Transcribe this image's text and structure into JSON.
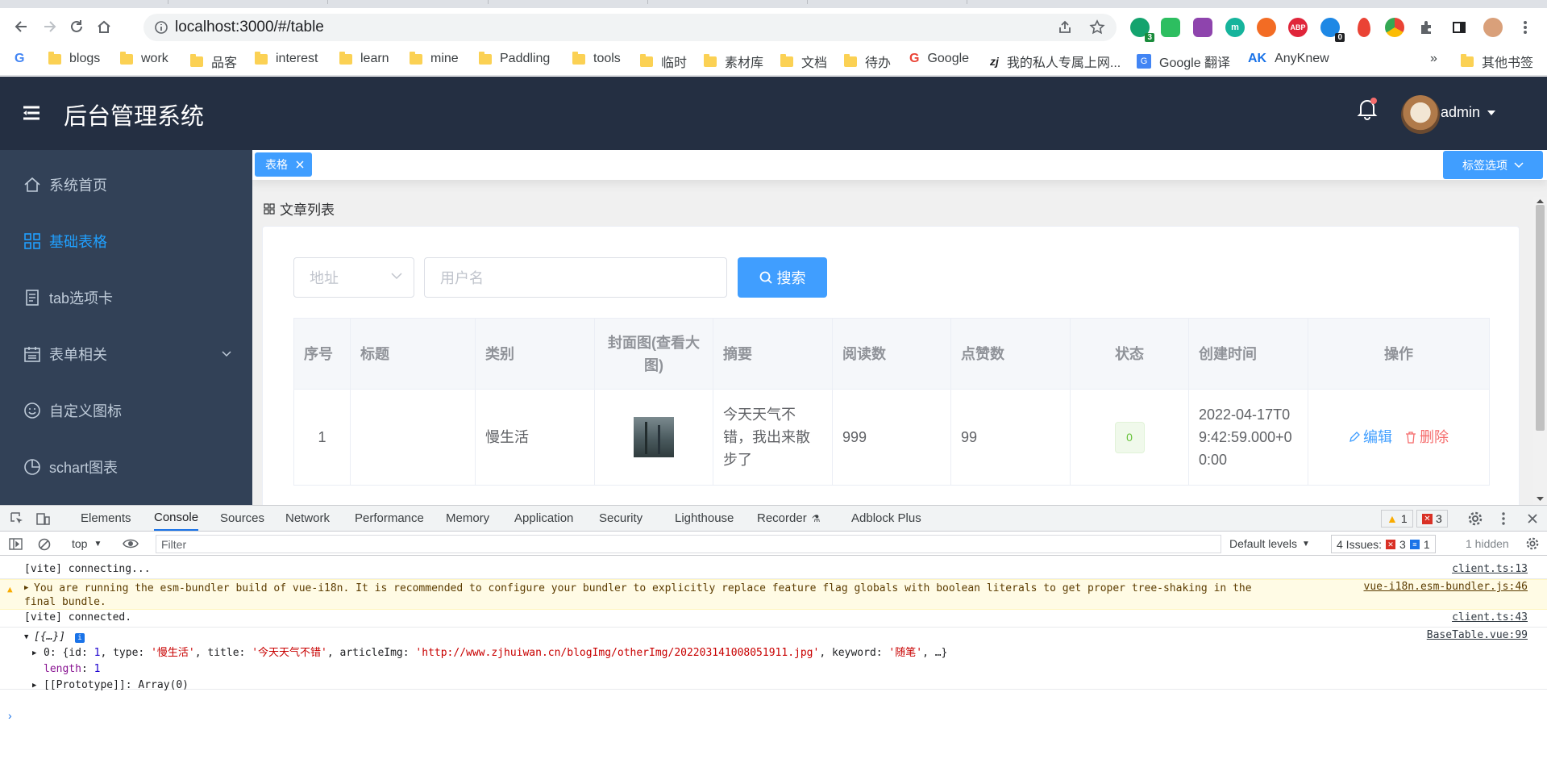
{
  "browser": {
    "url": "localhost:3000/#/table",
    "bookmarks": [
      "blogs",
      "work",
      "品客",
      "interest",
      "learn",
      "mine",
      "Paddling",
      "tools",
      "临时",
      "素材库",
      "文档",
      "待办"
    ],
    "bookmark_google": "Google",
    "bookmark_zj": "我的私人专属上网...",
    "bookmark_translate": "Google 翻译",
    "bookmark_anyknew": "AnyKnew",
    "bookmark_other": "其他书签",
    "ext_badges": {
      "first": "3",
      "second": "0"
    },
    "abp": "ABP"
  },
  "app": {
    "title": "后台管理系统",
    "user": "admin"
  },
  "sidebar": {
    "items": [
      {
        "label": "系统首页"
      },
      {
        "label": "基础表格"
      },
      {
        "label": "tab选项卡"
      },
      {
        "label": "表单相关"
      },
      {
        "label": "自定义图标"
      },
      {
        "label": "schart图表"
      }
    ]
  },
  "tags": {
    "active": "表格",
    "options": "标签选项"
  },
  "page": {
    "breadcrumb": "文章列表",
    "filter_address_placeholder": "地址",
    "filter_username_placeholder": "用户名",
    "search_label": "搜索"
  },
  "table": {
    "headers": [
      "序号",
      "标题",
      "类别",
      "封面图(查看大图)",
      "摘要",
      "阅读数",
      "点赞数",
      "状态",
      "创建时间",
      "操作"
    ],
    "row": {
      "index": "1",
      "title": "",
      "category": "慢生活",
      "summary": "今天天气不错，我出来散步了",
      "reads": "999",
      "likes": "99",
      "status": "0",
      "created": "2022-04-17T09:42:59.000+00:00",
      "edit": "编辑",
      "delete": "删除"
    }
  },
  "devtools": {
    "tabs": [
      "Elements",
      "Console",
      "Sources",
      "Network",
      "Performance",
      "Memory",
      "Application",
      "Security",
      "Lighthouse",
      "Recorder",
      "Adblock Plus"
    ],
    "warn_count": "1",
    "error_count": "3",
    "context": "top",
    "filter_placeholder": "Filter",
    "levels": "Default levels",
    "issues_label": "4 Issues:",
    "issues_err": "3",
    "issues_info": "1",
    "hidden": "1 hidden",
    "logs": {
      "l1": "[vite] connecting...",
      "l1_src": "client.ts:13",
      "l2": "You are running the esm-bundler build of vue-i18n. It is recommended to configure your bundler to explicitly replace feature flag globals with boolean literals to get proper tree-shaking in the",
      "l2b": "final bundle.",
      "l2_src": "vue-i18n.esm-bundler.js:46",
      "l3": "[vite] connected.",
      "l3_src": "client.ts:43",
      "l4": "[{…}]",
      "l4_src": "BaseTable.vue:99",
      "l5_pre": "0: {id: ",
      "l5_id": "1",
      "l5_type_k": ", type: ",
      "l5_type": "'慢生活'",
      "l5_title_k": ", title: ",
      "l5_title": "'今天天气不错'",
      "l5_img_k": ", articleImg: ",
      "l5_img": "'http://www.zjhuiwan.cn/blogImg/otherImg/202203141008051911.jpg'",
      "l5_kw_k": ", keyword: ",
      "l5_kw": "'随笔'",
      "l5_end": ", …}",
      "l6_k": "length",
      "l6_v": "1",
      "l7": "[[Prototype]]: Array(0)"
    }
  },
  "colors": {
    "header_bg": "#242f42",
    "sidebar_bg": "#324157",
    "accent": "#409eff",
    "danger": "#f56c6c",
    "success": "#67c23a"
  }
}
